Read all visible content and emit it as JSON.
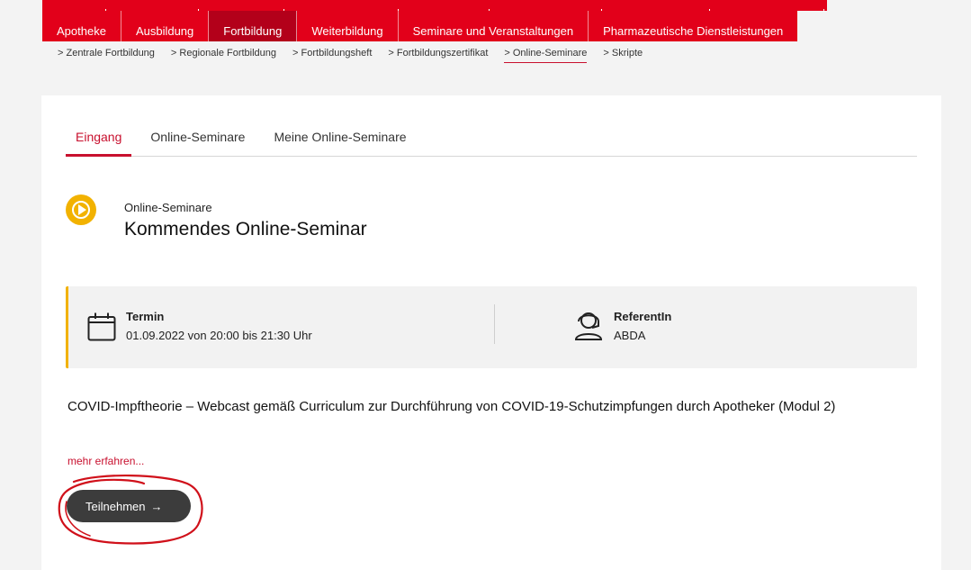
{
  "main_nav": [
    {
      "label": "Apotheke",
      "active": false
    },
    {
      "label": "Ausbildung",
      "active": false
    },
    {
      "label": "Fortbildung",
      "active": true
    },
    {
      "label": "Weiterbildung",
      "active": false
    },
    {
      "label": "Seminare und Veranstaltungen",
      "active": false
    },
    {
      "label": "Pharmazeutische Dienstleistungen",
      "active": false
    }
  ],
  "sub_nav": [
    {
      "label": "> Zentrale Fortbildung",
      "active": false
    },
    {
      "label": "> Regionale Fortbildung",
      "active": false
    },
    {
      "label": "> Fortbildungsheft",
      "active": false
    },
    {
      "label": "> Fortbildungszertifikat",
      "active": false
    },
    {
      "label": "> Online-Seminare",
      "active": true
    },
    {
      "label": "> Skripte",
      "active": false
    }
  ],
  "tabs": [
    {
      "label": "Eingang",
      "active": true
    },
    {
      "label": "Online-Seminare",
      "active": false
    },
    {
      "label": "Meine Online-Seminare",
      "active": false
    }
  ],
  "section": {
    "kicker": "Online-Seminare",
    "title": "Kommendes Online-Seminar",
    "icon": "play-circle-icon"
  },
  "info": {
    "termin_label": "Termin",
    "termin_value": "01.09.2022 von 20:00 bis 21:30 Uhr",
    "referent_label": "ReferentIn",
    "referent_value": "ABDA"
  },
  "description": "COVID-Impftheorie – Webcast gemäß Curriculum zur Durchführung von COVID-19-Schutzimpfungen durch Apotheker (Modul 2)",
  "more_link": "mehr erfahren...",
  "join_button": "Teilnehmen",
  "colors": {
    "brand_red": "#e2001a",
    "accent_yellow": "#f2b200",
    "button_dark": "#3c3c3c",
    "annotation_red": "#d0101a"
  }
}
